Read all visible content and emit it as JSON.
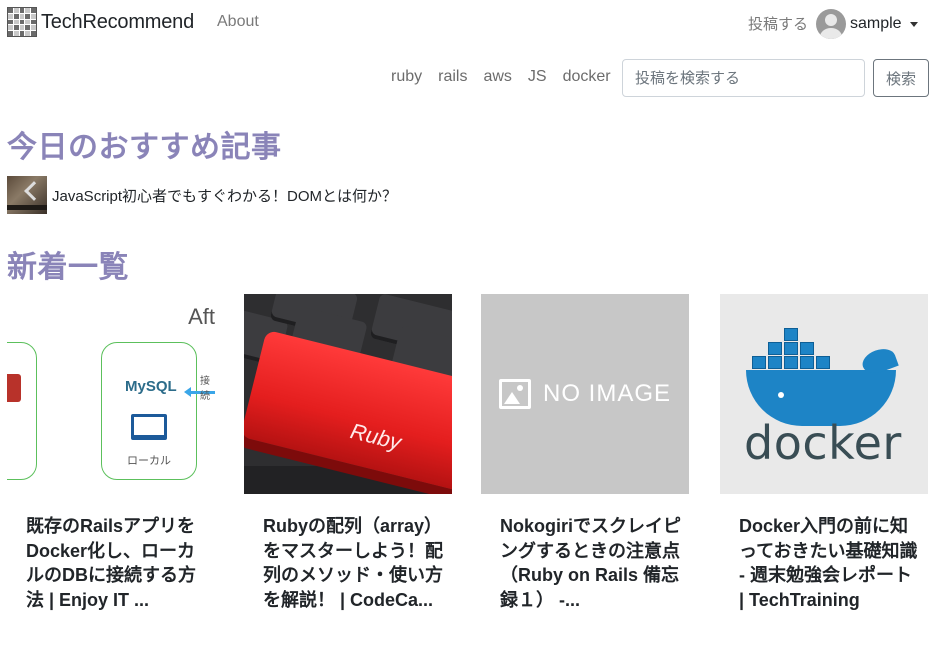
{
  "navbar": {
    "brand": "TechRecommend",
    "about": "About",
    "post": "投稿する",
    "user": "sample"
  },
  "tags": [
    "ruby",
    "rails",
    "aws",
    "JS",
    "docker"
  ],
  "search": {
    "placeholder": "投稿を検索する",
    "value": "",
    "button": "検索"
  },
  "today": {
    "heading": "今日のおすすめ記事",
    "article_title": "JavaScript初心者でもすぐわかる！DOMとは何か？"
  },
  "latest": {
    "heading": "新着一覧",
    "cards": [
      {
        "title": "既存のRailsアプリをDocker化し、ローカルのDBに接続する方法 | Enjoy IT ...",
        "image_text": [
          "Aft",
          "MySQL",
          "ローカル",
          "接続"
        ]
      },
      {
        "title": "Rubyの配列（array）をマスターしよう！配列のメソッド・使い方を解説！ | CodeCa...",
        "image_text": [
          "Ruby"
        ]
      },
      {
        "title": "Nokogiriでスクレイピングするときの注意点　（Ruby on Rails 備忘録１） -...",
        "image_text": [
          "NO IMAGE"
        ]
      },
      {
        "title": "Docker入門の前に知っておきたい基礎知識 - 週末勉強会レポート | TechTraining",
        "image_text": [
          "docker"
        ]
      }
    ]
  },
  "colors": {
    "heading": "#8a84b8",
    "docker_blue": "#1d84c6",
    "ruby_red": "#e41e1e"
  }
}
